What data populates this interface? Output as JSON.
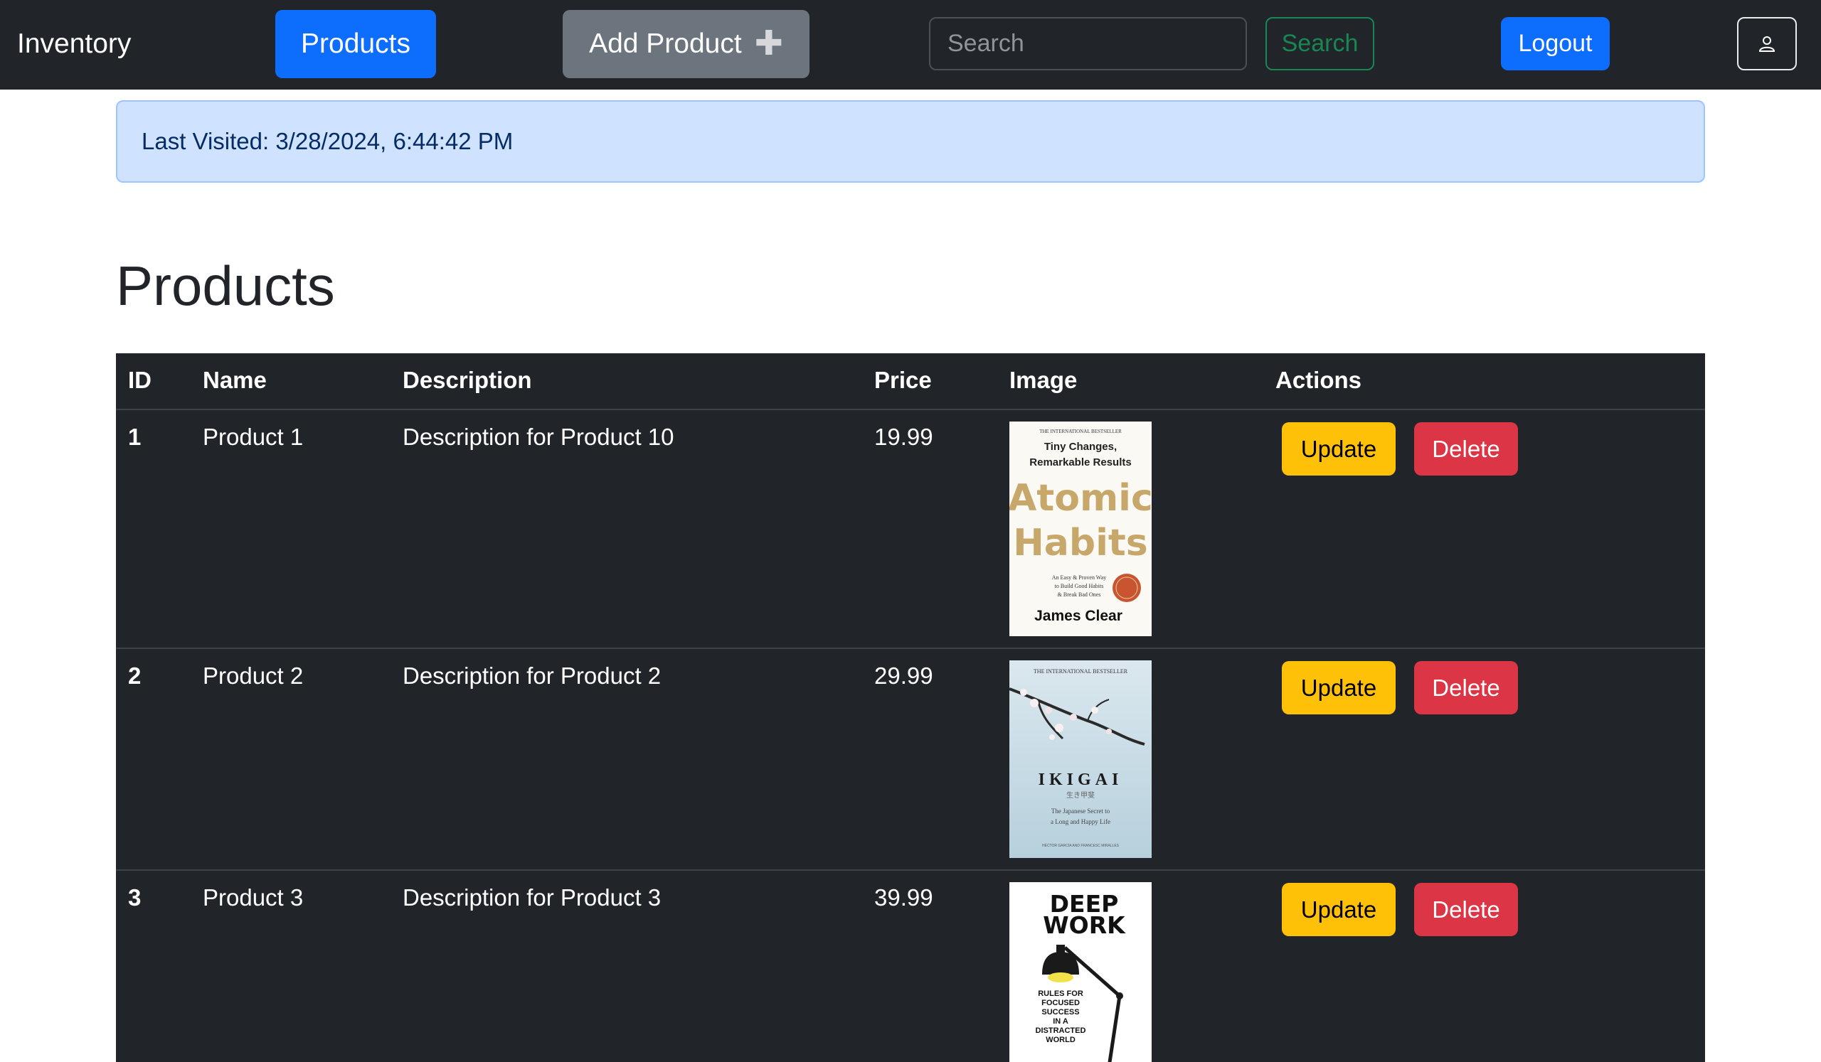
{
  "navbar": {
    "brand": "Inventory",
    "products_label": "Products",
    "add_product_label": "Add Product",
    "add_icon": "plus-icon",
    "search_placeholder": "Search",
    "search_button": "Search",
    "logout_label": "Logout",
    "user_icon": "user-icon"
  },
  "alert": {
    "text": "Last Visited: 3/28/2024, 6:44:42 PM"
  },
  "page": {
    "heading": "Products"
  },
  "table": {
    "headers": {
      "id": "ID",
      "name": "Name",
      "description": "Description",
      "price": "Price",
      "image": "Image",
      "actions": "Actions"
    },
    "rows": [
      {
        "id": "1",
        "name": "Product 1",
        "description": "Description for Product 10",
        "price": "19.99",
        "update": "Update",
        "delete": "Delete",
        "cover": {
          "top_line": "THE INTERNATIONAL BESTSELLER",
          "tagline_1": "Tiny Changes,",
          "tagline_2": "Remarkable Results",
          "title_1": "Atomic",
          "title_2": "Habits",
          "sub_1": "An Easy & Proven Way",
          "sub_2": "to Build Good Habits",
          "sub_3": "& Break Bad Ones",
          "author": "James Clear"
        }
      },
      {
        "id": "2",
        "name": "Product 2",
        "description": "Description for Product 2",
        "price": "29.99",
        "update": "Update",
        "delete": "Delete",
        "cover": {
          "top_line": "THE INTERNATIONAL BESTSELLER",
          "title": "IKIGAI",
          "kanji": "生き甲斐",
          "sub_1": "The Japanese Secret to",
          "sub_2": "a Long and Happy Life",
          "authors": "HÉCTOR GARCÍA AND FRANCESC MIRALLES"
        }
      },
      {
        "id": "3",
        "name": "Product 3",
        "description": "Description for Product 3",
        "price": "39.99",
        "update": "Update",
        "delete": "Delete",
        "cover": {
          "title_1": "DEEP",
          "title_2": "WORK",
          "sub_1": "RULES FOR",
          "sub_2": "FOCUSED",
          "sub_3": "SUCCESS",
          "sub_4": "IN A",
          "sub_5": "DISTRACTED",
          "sub_6": "WORLD"
        }
      }
    ]
  },
  "colors": {
    "navbar_bg": "#212529",
    "primary": "#0d6efd",
    "secondary": "#6c757d",
    "success": "#198754",
    "warning": "#ffc107",
    "danger": "#dc3545",
    "alert_bg": "#cfe2ff"
  }
}
